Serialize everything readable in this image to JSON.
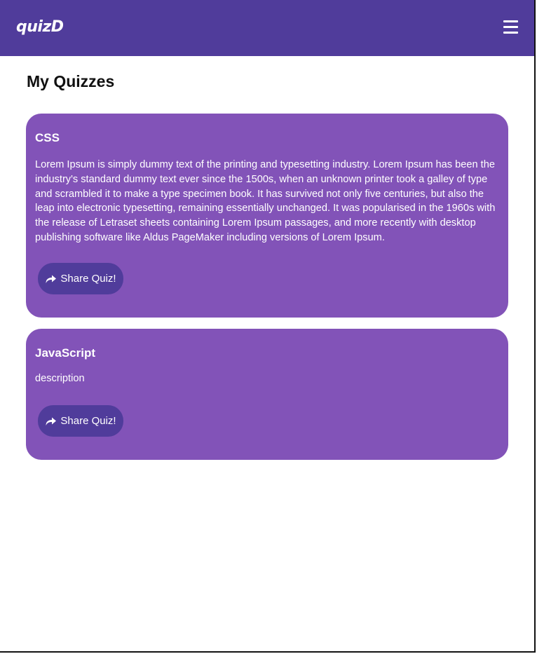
{
  "navbar": {
    "brand": "quizD",
    "menu_icon": "hamburger-menu-icon",
    "background_color": "#503c9b"
  },
  "page": {
    "title": "My Quizzes"
  },
  "quizzes": [
    {
      "title": "CSS",
      "description": "Lorem Ipsum is simply dummy text of the printing and typesetting industry. Lorem Ipsum has been the industry's standard dummy text ever since the 1500s, when an unknown printer took a galley of type and scrambled it to make a type specimen book. It has survived not only five centuries, but also the leap into electronic typesetting, remaining essentially unchanged. It was popularised in the 1960s with the release of Letraset sheets containing Lorem Ipsum passages, and more recently with desktop publishing software like Aldus PageMaker including versions of Lorem Ipsum.",
      "share_label": "Share Quiz!",
      "share_icon": "share-arrow-icon"
    },
    {
      "title": "JavaScript",
      "description": "description",
      "share_label": "Share Quiz!",
      "share_icon": "share-arrow-icon"
    }
  ],
  "colors": {
    "card": "#8253b8",
    "button": "#503c9b"
  }
}
